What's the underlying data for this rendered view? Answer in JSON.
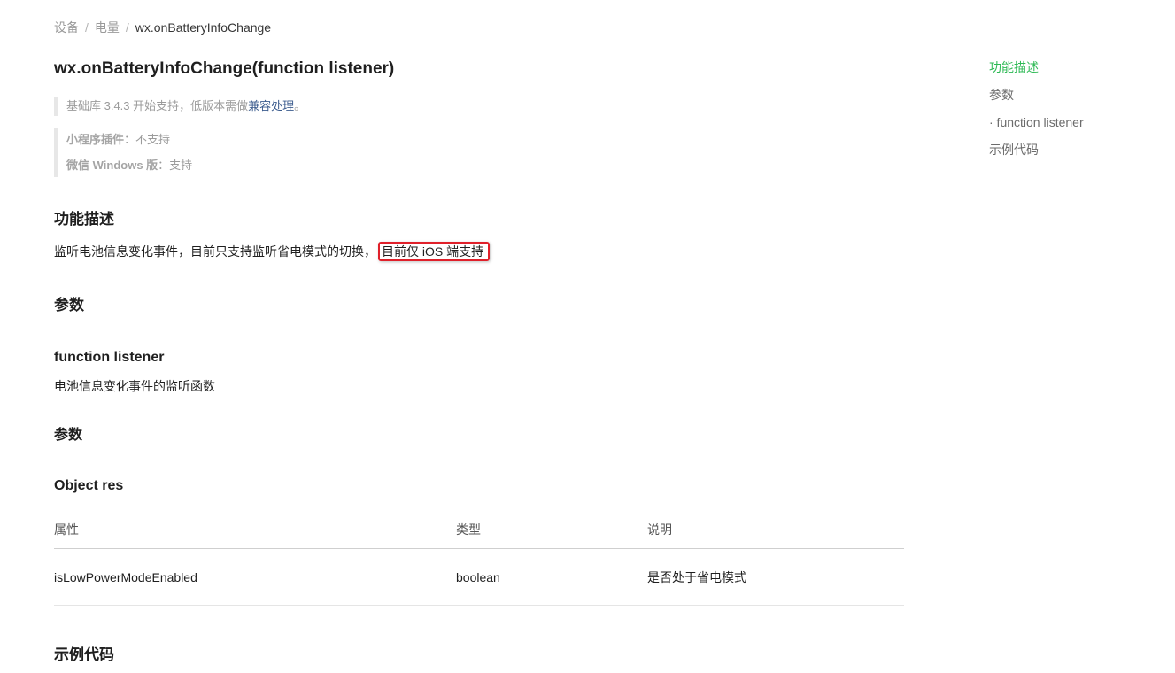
{
  "breadcrumb": {
    "items": [
      "设备",
      "电量",
      "wx.onBatteryInfoChange"
    ],
    "separator": "/"
  },
  "page": {
    "title": "wx.onBatteryInfoChange(function listener)"
  },
  "support": {
    "base_prefix": "基础库 3.4.3 开始支持，低版本需做",
    "compat_link": "兼容处理",
    "base_suffix": "。",
    "plugin_label": "小程序插件",
    "plugin_value": "：不支持",
    "windows_label": "微信 Windows 版",
    "windows_value": "：支持"
  },
  "sections": {
    "description_heading": "功能描述",
    "description_text": "监听电池信息变化事件，目前只支持监听省电模式的切换，",
    "description_highlight": "目前仅 iOS 端支持",
    "params_heading": "参数",
    "listener_heading": "function listener",
    "listener_text": "电池信息变化事件的监听函数",
    "listener_params_heading": "参数",
    "object_heading": "Object res",
    "example_heading": "示例代码"
  },
  "table": {
    "headers": [
      "属性",
      "类型",
      "说明"
    ],
    "rows": [
      [
        "isLowPowerModeEnabled",
        "boolean",
        "是否处于省电模式"
      ]
    ]
  },
  "toc": {
    "items": [
      "功能描述",
      "参数",
      "· function listener",
      "示例代码"
    ],
    "active_index": 0
  },
  "colors": {
    "toc_active": "#2fba56",
    "link": "#3c5c8e",
    "highlight_border": "#e0202a"
  }
}
